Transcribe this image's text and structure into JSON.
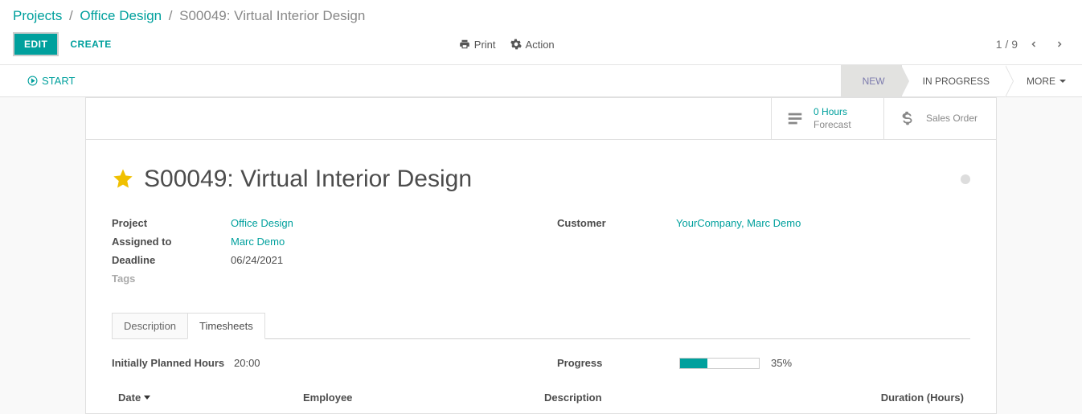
{
  "breadcrumb": {
    "l1": "Projects",
    "l2": "Office Design",
    "current": "S00049: Virtual Interior Design"
  },
  "controls": {
    "edit": "EDIT",
    "create": "CREATE",
    "print": "Print",
    "action": "Action",
    "pager": "1 / 9"
  },
  "statusbar": {
    "start": "START",
    "stages": {
      "new": "NEW",
      "in_progress": "IN PROGRESS",
      "more": "MORE"
    }
  },
  "stat_buttons": {
    "forecast": {
      "value": "0",
      "unit": "Hours",
      "label": "Forecast"
    },
    "sales_order": {
      "label": "Sales Order"
    }
  },
  "record": {
    "title": "S00049: Virtual Interior Design",
    "fields": {
      "project_label": "Project",
      "project_value": "Office Design",
      "assigned_label": "Assigned to",
      "assigned_value": "Marc Demo",
      "deadline_label": "Deadline",
      "deadline_value": "06/24/2021",
      "tags_label": "Tags",
      "customer_label": "Customer",
      "customer_value": "YourCompany, Marc Demo"
    }
  },
  "tabs": {
    "description": "Description",
    "timesheets": "Timesheets"
  },
  "timesheet": {
    "planned_label": "Initially Planned Hours",
    "planned_value": "20:00",
    "progress_label": "Progress",
    "progress_text": "35%",
    "progress_pct": 35,
    "columns": {
      "date": "Date",
      "employee": "Employee",
      "description": "Description",
      "duration": "Duration (Hours)"
    }
  }
}
